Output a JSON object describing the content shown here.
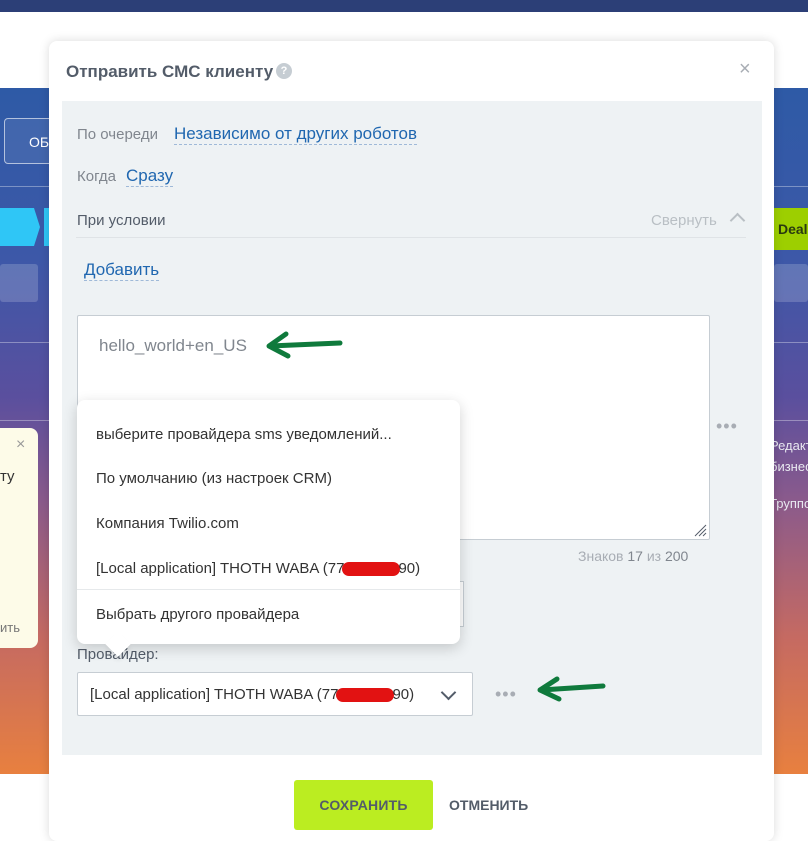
{
  "background": {
    "left_button_label": "ОБ",
    "stage_right_label": "Deal",
    "right_texts": [
      "Редакт",
      "бизнес",
      "Группо"
    ],
    "left_popup_text": "ту",
    "left_popup_link": "ить",
    "colors": {
      "top_strip": "#2c3f77",
      "stage_cyan": "#2fc6f6",
      "stage_green": "#9dcf00"
    }
  },
  "modal": {
    "title": "Отправить СМС клиенту",
    "help_icon": "?",
    "close_icon": "×",
    "queue_label": "По очереди",
    "queue_value": "Независимо от других роботов",
    "when_label": "Когда",
    "when_value": "Сразу",
    "condition_label": "При условии",
    "collapse_label": "Свернуть",
    "add_label": "Добавить",
    "message_text": "hello_world+en_US",
    "counter_prefix": "Знаков",
    "counter_value": "17",
    "counter_mid": "из",
    "counter_max": "200",
    "dots": "•••",
    "provider_label": "Провайдер:",
    "provider_value_start": "[Local application] THOTH WABA (77",
    "provider_value_end": "90)",
    "dropdown": {
      "items": [
        "выберите провайдера sms уведомлений...",
        "По умолчанию (из настроек CRM)",
        "Компания Twilio.com"
      ],
      "local_item_start": "[Local application] THOTH WABA (77",
      "local_item_end": "90)",
      "other_provider": "Выбрать другого провайдера"
    },
    "save_label": "СОХРАНИТЬ",
    "cancel_label": "ОТМЕНИТЬ",
    "colors": {
      "link": "#2067b0",
      "save_button": "#bbed21",
      "arrow": "#0f7a3c",
      "redaction": "#e21212"
    }
  }
}
